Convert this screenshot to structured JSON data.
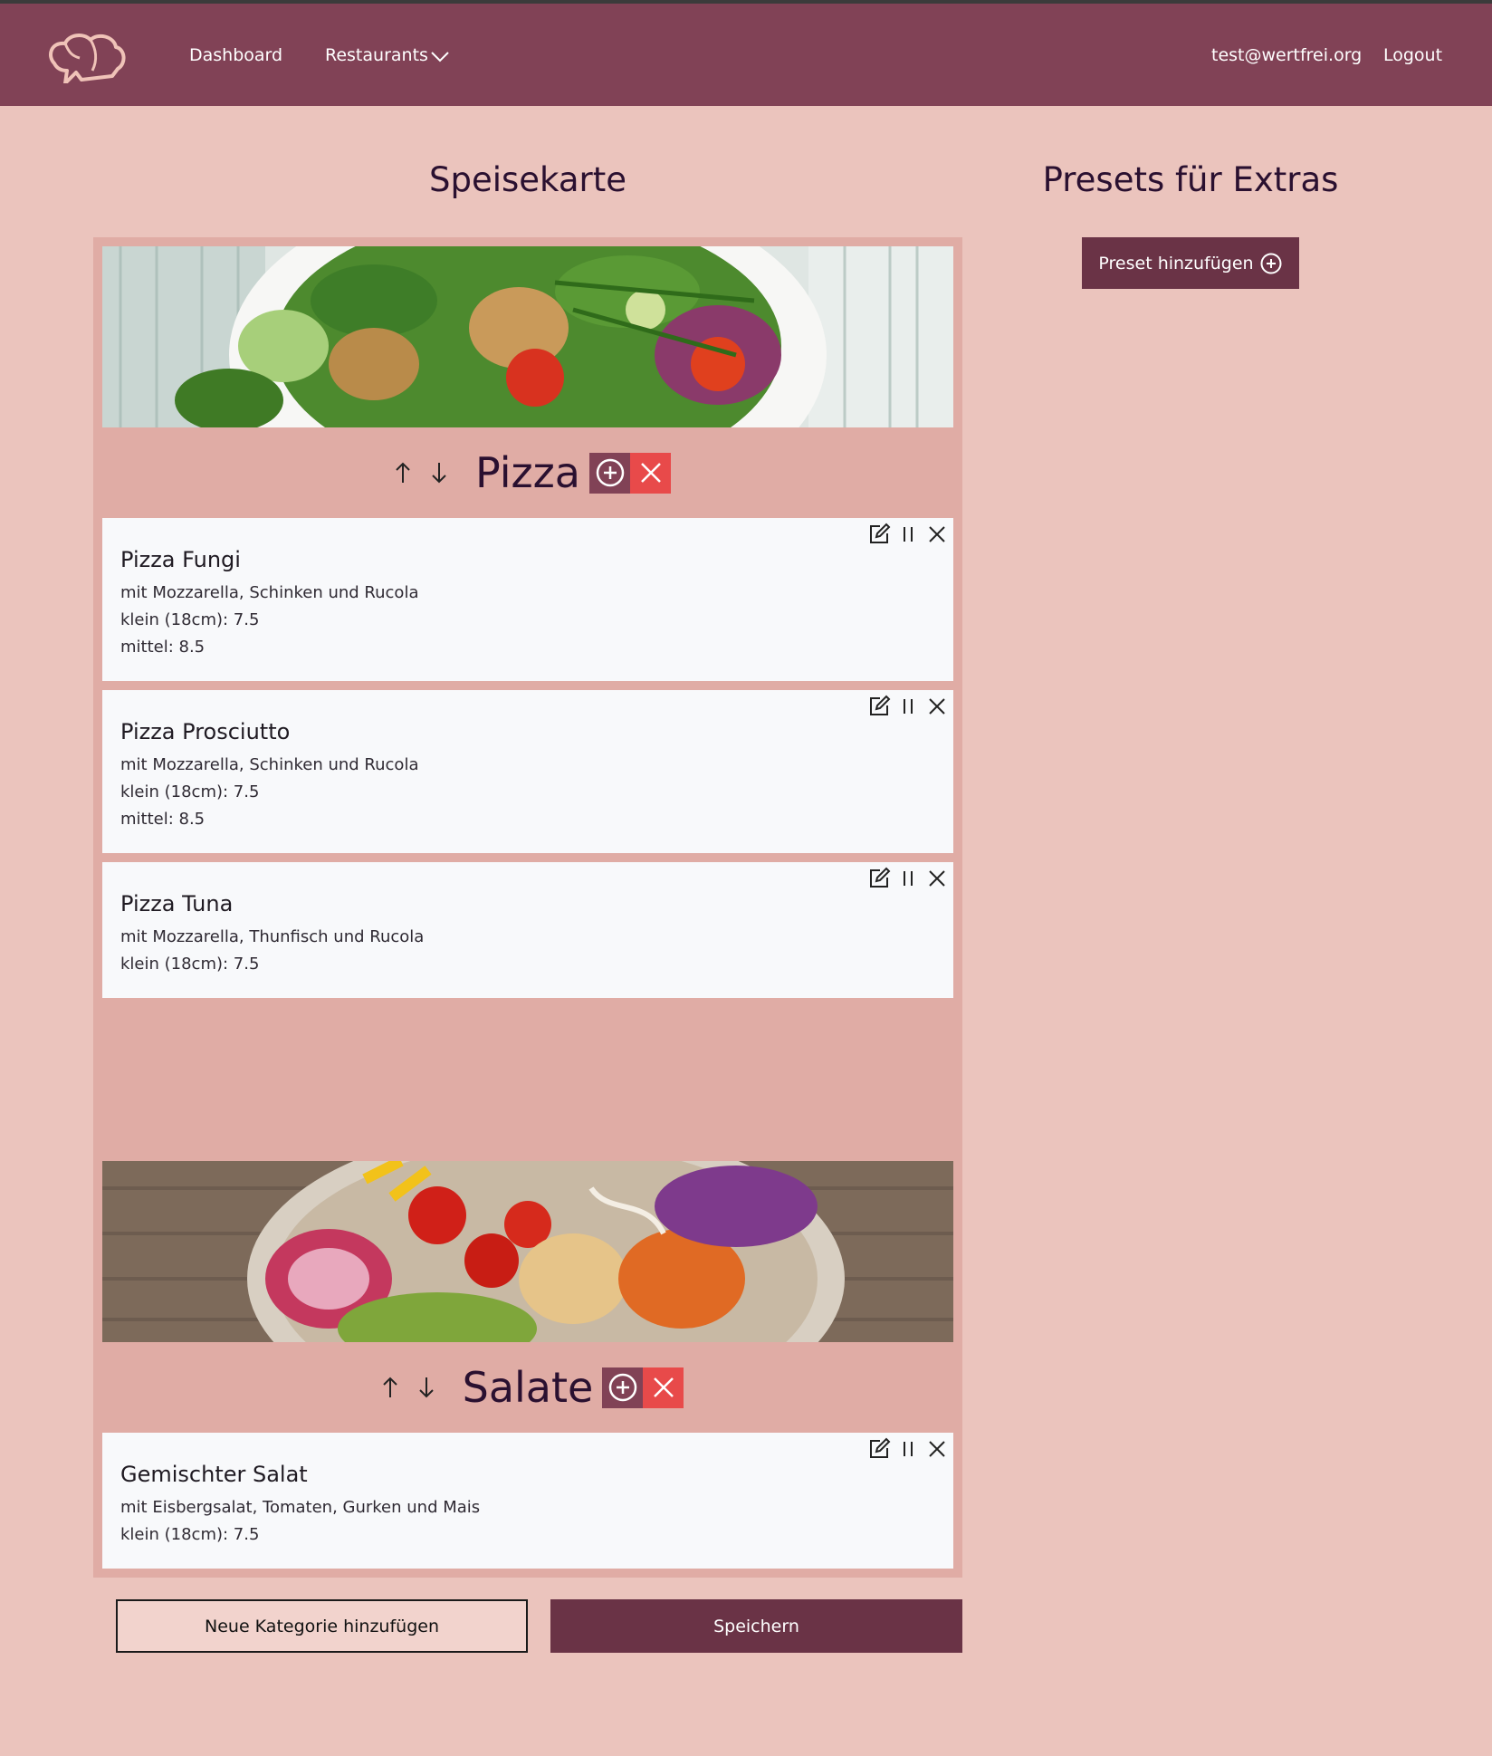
{
  "nav": {
    "dashboard": "Dashboard",
    "restaurants": "Restaurants",
    "user_email": "test@wertfrei.org",
    "logout": "Logout"
  },
  "menu": {
    "heading": "Speisekarte",
    "categories": [
      {
        "title": "Pizza",
        "items": [
          {
            "title": "Pizza Fungi",
            "description": "mit Mozzarella, Schinken und Rucola",
            "prices": [
              "klein (18cm): 7.5",
              "mittel: 8.5"
            ]
          },
          {
            "title": "Pizza Prosciutto",
            "description": "mit Mozzarella, Schinken und Rucola",
            "prices": [
              "klein (18cm): 7.5",
              "mittel: 8.5"
            ]
          },
          {
            "title": "Pizza Tuna",
            "description": "mit Mozzarella, Thunfisch und Rucola",
            "prices": [
              "klein (18cm): 7.5"
            ]
          }
        ]
      },
      {
        "title": "Salate",
        "items": [
          {
            "title": "Gemischter Salat",
            "description": "mit Eisbergsalat, Tomaten, Gurken und Mais",
            "prices": [
              "klein (18cm): 7.5"
            ]
          }
        ]
      }
    ],
    "add_category_label": "Neue Kategorie hinzufügen",
    "save_label": "Speichern"
  },
  "presets": {
    "heading": "Presets für Extras",
    "add_label": "Preset hinzufügen"
  },
  "colors": {
    "navbar": "#814256",
    "page_bg": "#ebc4bd",
    "panel_bg": "#e0aca5",
    "primary_button": "#6a3346",
    "delete_red": "#e84a4a"
  },
  "icons": {
    "logo": "chef-hat-logo-icon",
    "dropdown": "chevron-down-icon",
    "move_up": "arrow-up-icon",
    "move_down": "arrow-down-icon",
    "add": "plus-circle-icon",
    "delete": "close-icon",
    "edit": "edit-icon",
    "pause": "pause-icon"
  }
}
